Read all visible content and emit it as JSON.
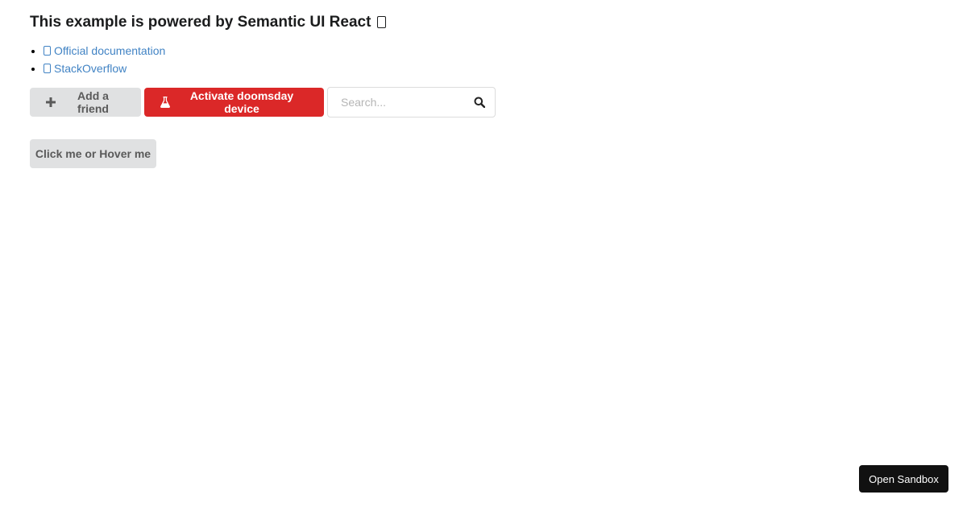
{
  "header": {
    "title": "This example is powered by Semantic UI React"
  },
  "links": [
    {
      "label": "Official documentation"
    },
    {
      "label": "StackOverflow"
    }
  ],
  "toolbar": {
    "add_friend_label": "Add a friend",
    "doomsday_label": "Activate doomsday device",
    "search_placeholder": "Search..."
  },
  "hover_button": {
    "label": "Click me or Hover me"
  },
  "sandbox": {
    "label": "Open Sandbox"
  },
  "colors": {
    "danger": "#db2828",
    "link": "#4183c4",
    "neutral_button": "#e0e1e2"
  },
  "icons": [
    "missing-glyph-icon",
    "plus-icon",
    "flask-icon",
    "search-icon"
  ]
}
